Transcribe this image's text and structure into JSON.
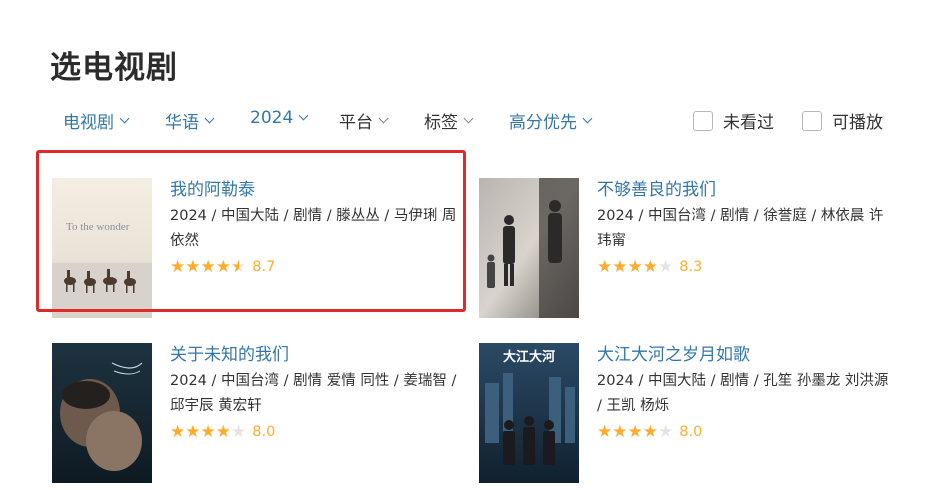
{
  "page": {
    "title": "选电视剧"
  },
  "filters": [
    {
      "label": "电视剧",
      "active": true
    },
    {
      "label": "华语",
      "active": true
    },
    {
      "label": "2024",
      "active": true
    },
    {
      "label": "平台",
      "active": false
    },
    {
      "label": "标签",
      "active": false
    },
    {
      "label": "高分优先",
      "active": true
    }
  ],
  "checks": [
    {
      "label": "未看过"
    },
    {
      "label": "可播放"
    }
  ],
  "shows": [
    {
      "title": "我的阿勒泰",
      "meta": "2024 / 中国大陆 / 剧情 / 滕丛丛 / 马伊琍 周依然",
      "stars": 4.5,
      "score": "8.7",
      "poster_text": "To the wonder"
    },
    {
      "title": "不够善良的我们",
      "meta": "2024 / 中国台湾 / 剧情 / 徐誉庭 / 林依晨 许玮甯",
      "stars": 4,
      "score": "8.3"
    },
    {
      "title": "关于未知的我们",
      "meta": "2024 / 中国台湾 / 剧情 爱情 同性 / 姜瑞智 / 邱宇辰 黄宏轩",
      "stars": 4,
      "score": "8.0"
    },
    {
      "title": "大江大河之岁月如歌",
      "meta": "2024 / 中国大陆 / 剧情 / 孔笙 孙墨龙 刘洪源 / 王凯 杨烁",
      "stars": 4,
      "score": "8.0",
      "poster_text": "大江大河"
    }
  ],
  "colors": {
    "accent": "#3377aa",
    "star": "#ffac2d",
    "highlight": "#e02a2a"
  }
}
